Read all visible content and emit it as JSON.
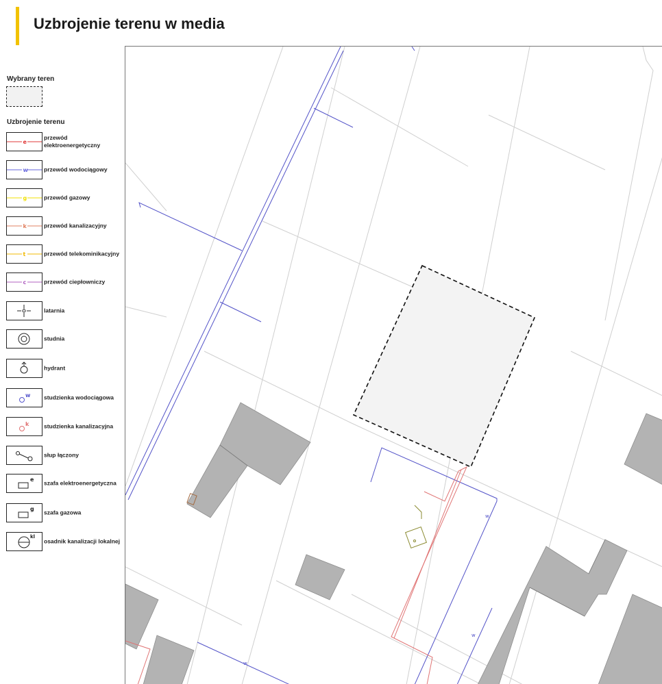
{
  "header": {
    "title": "Uzbrojenie terenu w media",
    "accent_color": "#f2c200"
  },
  "legend": {
    "selected_heading": "Wybrany teren",
    "utilities_heading": "Uzbrojenie terenu",
    "items": [
      {
        "key": "electric",
        "label": "przewód elektroenergetyczny",
        "symbol": "line",
        "letter": "e",
        "color": "#e03a3a"
      },
      {
        "key": "water",
        "label": "przewód wodociągowy",
        "symbol": "line",
        "letter": "w",
        "color": "#6666dd"
      },
      {
        "key": "gas",
        "label": "przewód gazowy",
        "symbol": "line",
        "letter": "g",
        "color": "#f0e000"
      },
      {
        "key": "sewer",
        "label": "przewód kanalizacyjny",
        "symbol": "line",
        "letter": "k",
        "color": "#e08060"
      },
      {
        "key": "telecom",
        "label": "przewód telekominikacyjny",
        "symbol": "line",
        "letter": "t",
        "color": "#f0b800"
      },
      {
        "key": "heat",
        "label": "przewód ciepłowniczy",
        "symbol": "line",
        "letter": "c",
        "color": "#b060c0"
      },
      {
        "key": "lamp",
        "label": "latarnia",
        "symbol": "lamp-icon"
      },
      {
        "key": "well",
        "label": "studnia",
        "symbol": "well-icon"
      },
      {
        "key": "hydrant",
        "label": "hydrant",
        "symbol": "hydrant-icon"
      },
      {
        "key": "water_manhole",
        "label": "studzienka wodociągowa",
        "symbol": "manhole-icon",
        "letter": "w",
        "color": "#5555cc"
      },
      {
        "key": "sewer_manhole",
        "label": "studzienka kanalizacyjna",
        "symbol": "manhole-icon",
        "letter": "k",
        "color": "#e07070"
      },
      {
        "key": "pole",
        "label": "słup łączony",
        "symbol": "pole-icon"
      },
      {
        "key": "electric_cabinet",
        "label": "szafa elektroenergetyczna",
        "symbol": "cabinet-icon",
        "letter": "e"
      },
      {
        "key": "gas_cabinet",
        "label": "szafa gazowa",
        "symbol": "cabinet-icon",
        "letter": "g"
      },
      {
        "key": "septic",
        "label": "osadnik kanalizacji lokalnej",
        "symbol": "septic-icon",
        "letter": "kl"
      }
    ]
  },
  "map": {
    "colors": {
      "building": "#b3b3b3",
      "parcel_line": "#c8c8c8",
      "selected_fill": "#f3f3f3",
      "selected_border": "#111111"
    },
    "pipe_labels": [
      {
        "layer": "water",
        "letter": "w"
      }
    ]
  }
}
